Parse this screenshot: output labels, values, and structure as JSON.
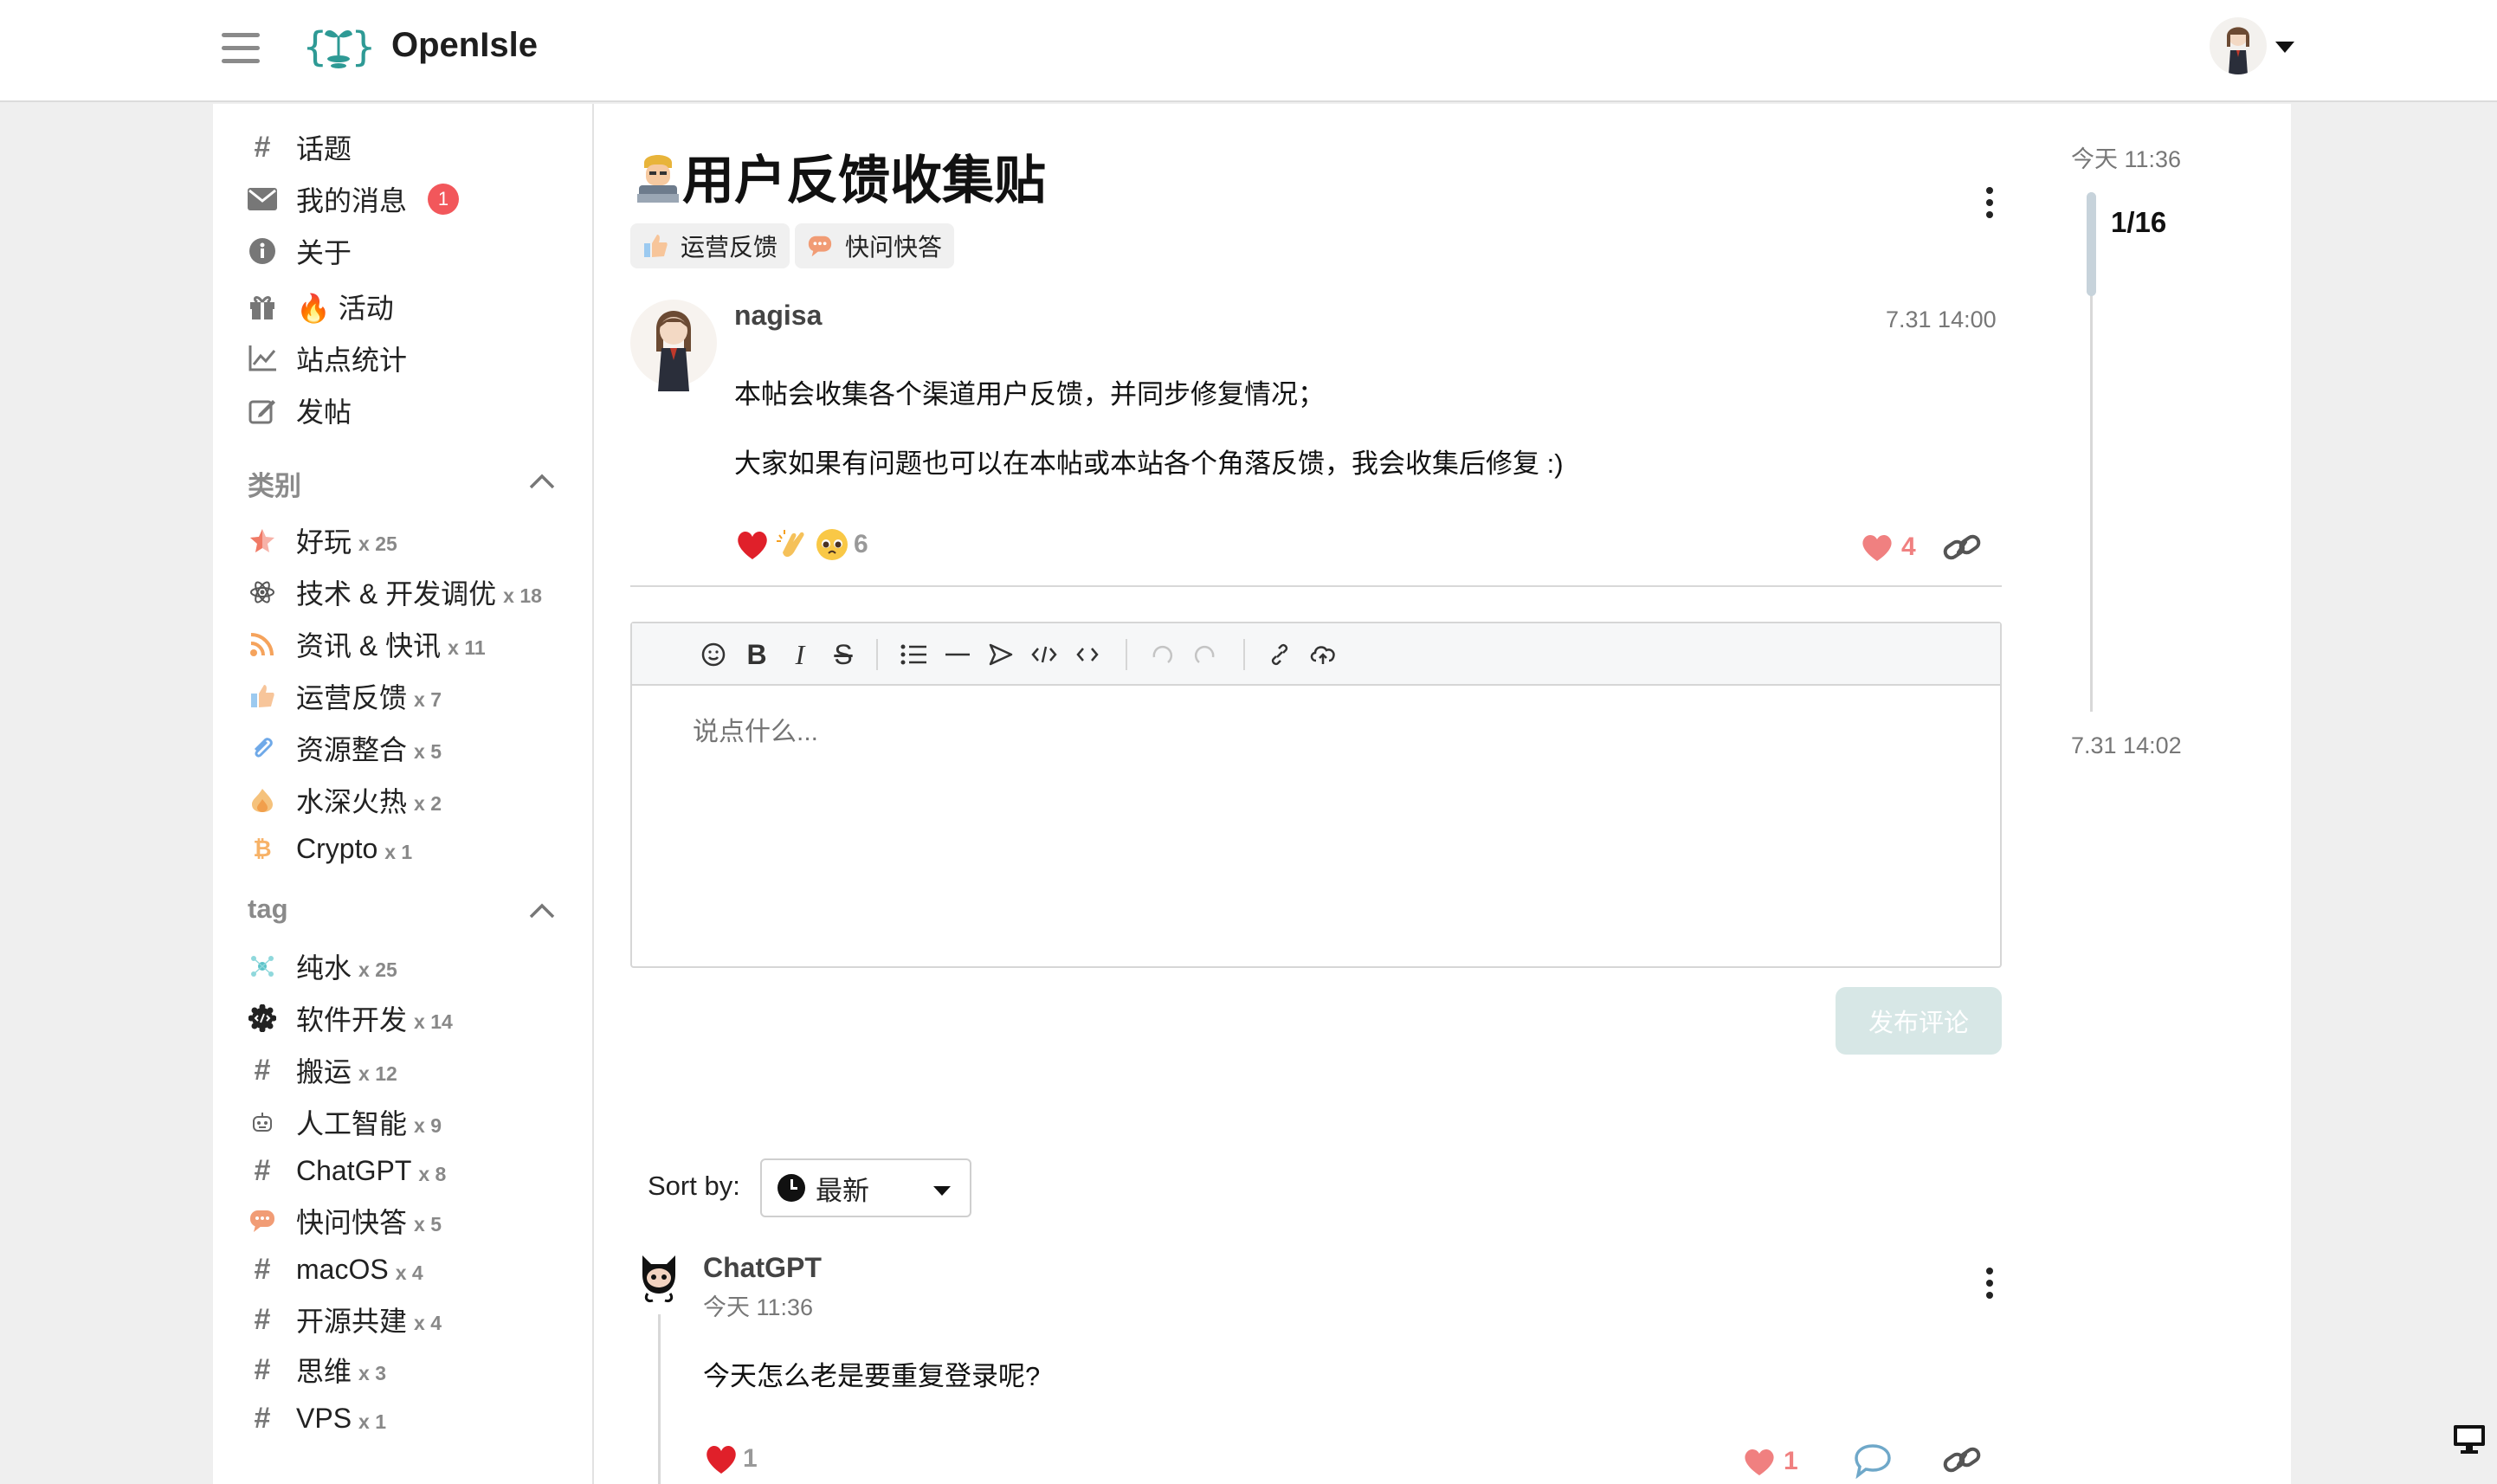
{
  "header": {
    "brand": "OpenIsle"
  },
  "sidebar": {
    "nav": [
      {
        "label": "话题",
        "icon": "hash-icon"
      },
      {
        "label": "我的消息",
        "icon": "mail-icon",
        "badge": "1"
      },
      {
        "label": "关于",
        "icon": "info-icon"
      },
      {
        "label": "🔥 活动",
        "icon": "gift-icon"
      },
      {
        "label": "站点统计",
        "icon": "chart-icon"
      },
      {
        "label": "发帖",
        "icon": "edit-icon"
      }
    ],
    "categories_title": "类别",
    "categories": [
      {
        "label": "好玩",
        "count": "x 25",
        "icon": "star-icon"
      },
      {
        "label": "技术 & 开发调优",
        "count": "x 18",
        "icon": "atom-icon"
      },
      {
        "label": "资讯 & 快讯",
        "count": "x 11",
        "icon": "rss-icon"
      },
      {
        "label": "运营反馈",
        "count": "x 7",
        "icon": "thumbs-up-icon"
      },
      {
        "label": "资源整合",
        "count": "x 5",
        "icon": "paperclip-icon"
      },
      {
        "label": "水深火热",
        "count": "x 2",
        "icon": "fire-icon"
      },
      {
        "label": "Crypto",
        "count": "x 1",
        "icon": "bitcoin-icon"
      }
    ],
    "tags_title": "tag",
    "tags": [
      {
        "label": "纯水",
        "count": "x 25",
        "icon": "molecule-icon"
      },
      {
        "label": "软件开发",
        "count": "x 14",
        "icon": "gear-code-icon"
      },
      {
        "label": "搬运",
        "count": "x 12",
        "icon": "hash-icon"
      },
      {
        "label": "人工智能",
        "count": "x 9",
        "icon": "robot-icon"
      },
      {
        "label": "ChatGPT",
        "count": "x 8",
        "icon": "hash-icon"
      },
      {
        "label": "快问快答",
        "count": "x 5",
        "icon": "chat-icon"
      },
      {
        "label": "macOS",
        "count": "x 4",
        "icon": "hash-icon"
      },
      {
        "label": "开源共建",
        "count": "x 4",
        "icon": "hash-icon"
      },
      {
        "label": "思维",
        "count": "x 3",
        "icon": "hash-icon"
      },
      {
        "label": "VPS",
        "count": "x 1",
        "icon": "hash-icon"
      }
    ]
  },
  "post": {
    "title": "用户反馈收集贴",
    "title_emoji": "technologist-emoji",
    "chips": [
      {
        "label": "运营反馈",
        "icon": "thumbs-up-icon"
      },
      {
        "label": "快问快答",
        "icon": "chat-icon"
      }
    ],
    "author": "nagisa",
    "time": "7.31 14:00",
    "paragraphs": [
      "本帖会收集各个渠道用户反馈，并同步修复情况；",
      "大家如果有问题也可以在本帖或本站各个角落反馈，我会收集后修复 :)"
    ],
    "reaction_count": "6",
    "like_count": "4"
  },
  "editor": {
    "placeholder": "说点什么...",
    "submit_label": "发布评论"
  },
  "sort": {
    "label": "Sort by:",
    "value": "最新"
  },
  "comment": {
    "author": "ChatGPT",
    "time": "今天 11:36",
    "text": "今天怎么老是要重复登录呢?",
    "reaction_count": "1",
    "like_count": "1"
  },
  "timeline": {
    "top_time": "今天 11:36",
    "position": "1/16",
    "bottom_time": "7.31 14:02"
  },
  "colors": {
    "accent": "#2e9a95",
    "like": "#f08080",
    "badge": "#f2575b"
  }
}
